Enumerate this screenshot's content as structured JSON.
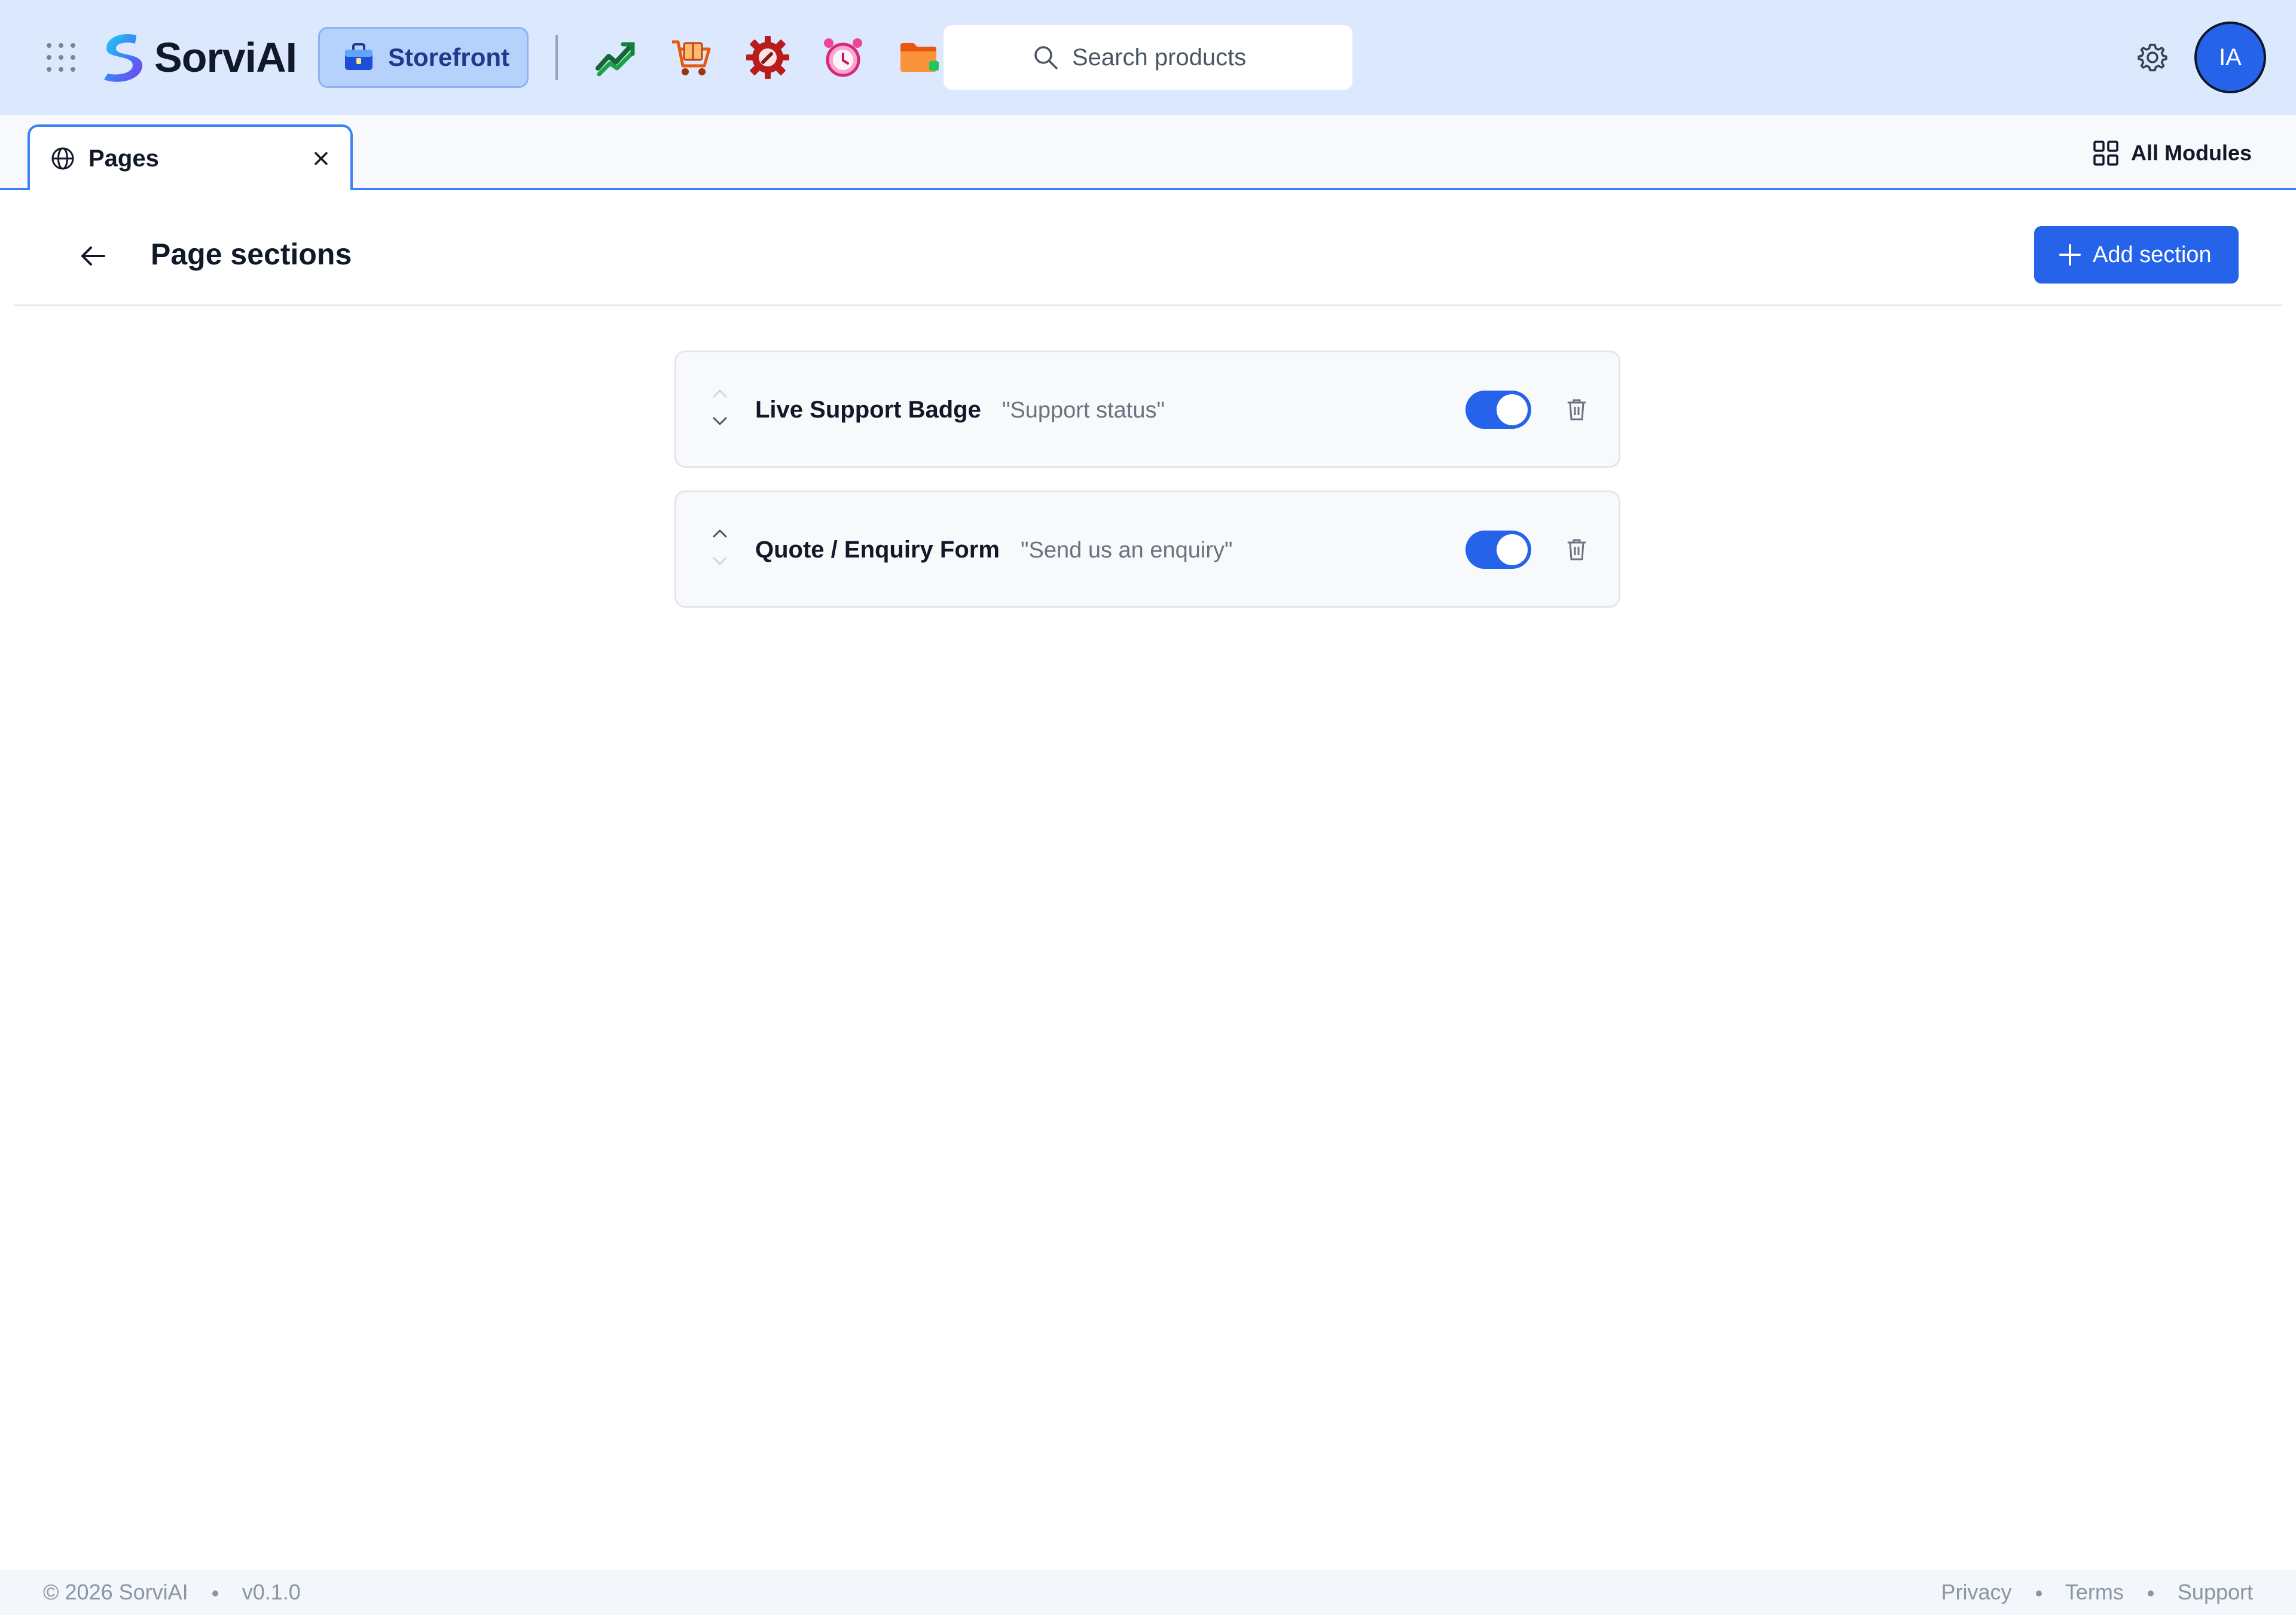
{
  "app": {
    "name": "SorviAI"
  },
  "topbar": {
    "module_label": "Storefront",
    "search_placeholder": "Search products",
    "avatar_initials": "IA",
    "quick_icons": [
      "analytics-icon",
      "shopping-cart-icon",
      "service-gear-icon",
      "alarm-clock-icon",
      "folder-icon"
    ]
  },
  "tabs": [
    {
      "label": "Pages",
      "icon": "globe-icon"
    }
  ],
  "tabbar": {
    "all_modules_label": "All Modules"
  },
  "header": {
    "title": "Page sections",
    "add_button_label": "Add section"
  },
  "sections": [
    {
      "name": "Live Support Badge",
      "subtitle": "\"Support status\"",
      "enabled": true
    },
    {
      "name": "Quote / Enquiry Form",
      "subtitle": "\"Send us an enquiry\"",
      "enabled": true
    }
  ],
  "footer": {
    "copyright": "© 2026 SorviAI",
    "version": "v0.1.0",
    "links": [
      "Privacy",
      "Terms",
      "Support"
    ]
  },
  "colors": {
    "topbar_bg": "#dbe8fd",
    "accent": "#2563eb",
    "tab_border": "#3b82f6"
  }
}
